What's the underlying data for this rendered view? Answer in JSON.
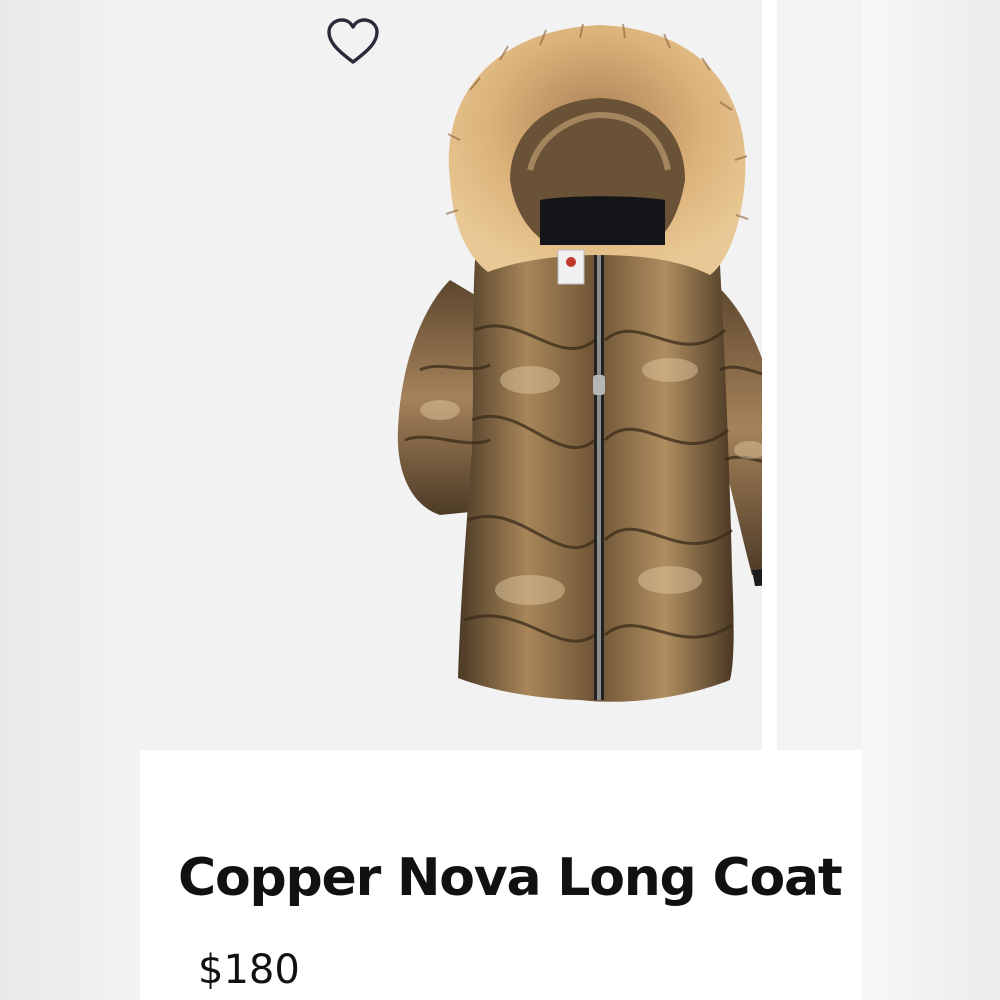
{
  "product": {
    "title": "Copper Nova Long Coat",
    "price": "$180"
  },
  "icons": {
    "favorite": "heart-outline-icon"
  },
  "colors": {
    "page_background": "#f1f1f1",
    "card_background": "#ffffff",
    "image_background": "#f3f2f3",
    "text": "#111111",
    "coat_copper": "#8a6a45",
    "fur": "#d7b07c"
  }
}
